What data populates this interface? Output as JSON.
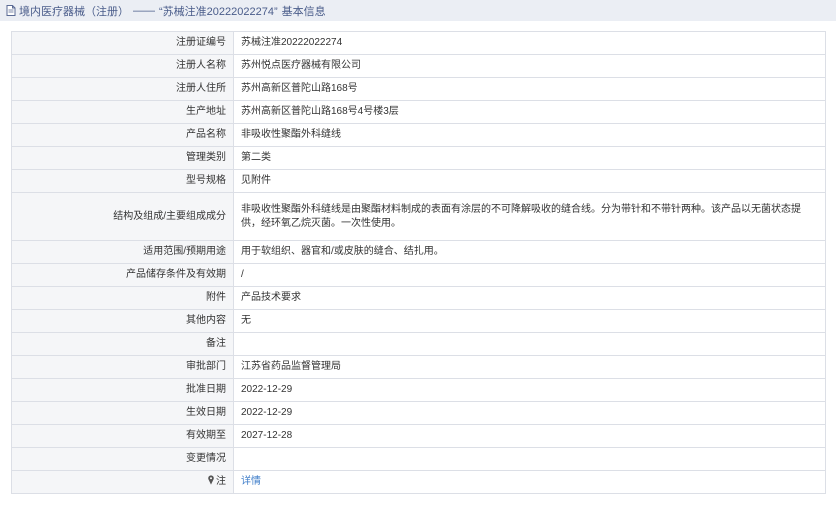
{
  "header": {
    "section": "境内医疗器械（注册）",
    "separator": "——",
    "record": "“苏械注准20222022274”",
    "suffix": "基本信息"
  },
  "rows": [
    {
      "label": "注册证编号",
      "value": "苏械注准20222022274"
    },
    {
      "label": "注册人名称",
      "value": "苏州悦点医疗器械有限公司"
    },
    {
      "label": "注册人住所",
      "value": "苏州高新区普陀山路168号"
    },
    {
      "label": "生产地址",
      "value": "苏州高新区普陀山路168号4号楼3层"
    },
    {
      "label": "产品名称",
      "value": "非吸收性聚酯外科缝线"
    },
    {
      "label": "管理类别",
      "value": "第二类"
    },
    {
      "label": "型号规格",
      "value": "见附件"
    },
    {
      "label": "结构及组成/主要组成成分",
      "value": "非吸收性聚酯外科缝线是由聚酯材料制成的表面有涂层的不可降解吸收的缝合线。分为带针和不带针两种。该产品以无菌状态提供，经环氧乙烷灭菌。一次性使用。"
    },
    {
      "label": "适用范围/预期用途",
      "value": "用于软组织、器官和/或皮肤的缝合、结扎用。"
    },
    {
      "label": "产品储存条件及有效期",
      "value": "/"
    },
    {
      "label": "附件",
      "value": "产品技术要求"
    },
    {
      "label": "其他内容",
      "value": "无"
    },
    {
      "label": "备注",
      "value": ""
    },
    {
      "label": "审批部门",
      "value": "江苏省药品监督管理局"
    },
    {
      "label": "批准日期",
      "value": "2022-12-29"
    },
    {
      "label": "生效日期",
      "value": "2022-12-29"
    },
    {
      "label": "有效期至",
      "value": "2027-12-28"
    },
    {
      "label": "变更情况",
      "value": ""
    }
  ],
  "note_row": {
    "label": "注",
    "link": "详情"
  }
}
